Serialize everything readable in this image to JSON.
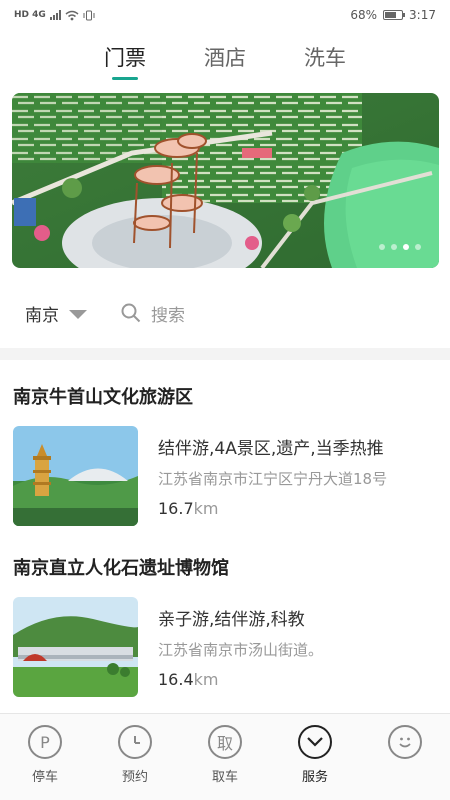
{
  "status_bar": {
    "indicators": "HD 4G",
    "battery_text": "68%",
    "battery_level": 0.68,
    "time": "3:17"
  },
  "tabs": [
    {
      "label": "门票",
      "active": true
    },
    {
      "label": "酒店",
      "active": false
    },
    {
      "label": "洗车",
      "active": false
    }
  ],
  "banner": {
    "slide_count": 4,
    "active_slide": 2
  },
  "filter": {
    "city": "南京",
    "search_placeholder": "搜索"
  },
  "spots": [
    {
      "name": "南京牛首山文化旅游区",
      "tags": "结伴游,4A景区,遗产,当季热推",
      "address": "江苏省南京市江宁区宁丹大道18号",
      "distance": "16.7",
      "unit": "km"
    },
    {
      "name": "南京直立人化石遗址博物馆",
      "tags": "亲子游,结伴游,科教",
      "address": "江苏省南京市汤山街道。",
      "distance": "16.4",
      "unit": "km"
    }
  ],
  "bottom_nav": [
    {
      "label": "停车",
      "glyph": "P",
      "icon": "parking-icon"
    },
    {
      "label": "预约",
      "glyph": "clock",
      "icon": "clock-icon"
    },
    {
      "label": "取车",
      "glyph": "取",
      "icon": "pickup-car-icon"
    },
    {
      "label": "服务",
      "glyph": "chevron",
      "icon": "chevron-down-icon",
      "active": true
    },
    {
      "label": "",
      "glyph": "smile",
      "icon": "smiley-icon"
    }
  ],
  "colors": {
    "accent": "#18a58f"
  }
}
